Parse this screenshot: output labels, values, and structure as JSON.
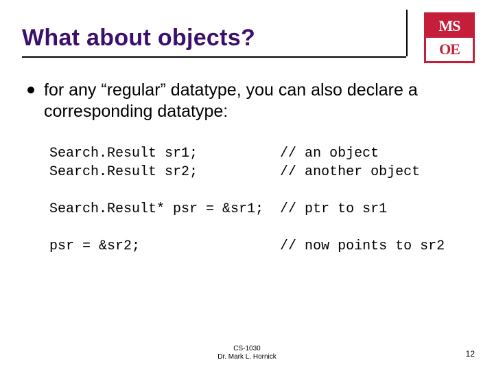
{
  "logo": {
    "top": "MS",
    "bottom": "OE"
  },
  "title": "What about objects?",
  "bullet": "for any “regular” datatype, you can also declare a corresponding datatype:",
  "code": {
    "l1": "Search.Result sr1;          // an object",
    "l2": "Search.Result sr2;          // another object",
    "l3": "",
    "l4": "Search.Result* psr = &sr1;  // ptr to sr1",
    "l5": "",
    "l6": "psr = &sr2;                 // now points to sr2"
  },
  "footer": {
    "course": "CS-1030",
    "author": "Dr. Mark L. Hornick"
  },
  "page": "12"
}
